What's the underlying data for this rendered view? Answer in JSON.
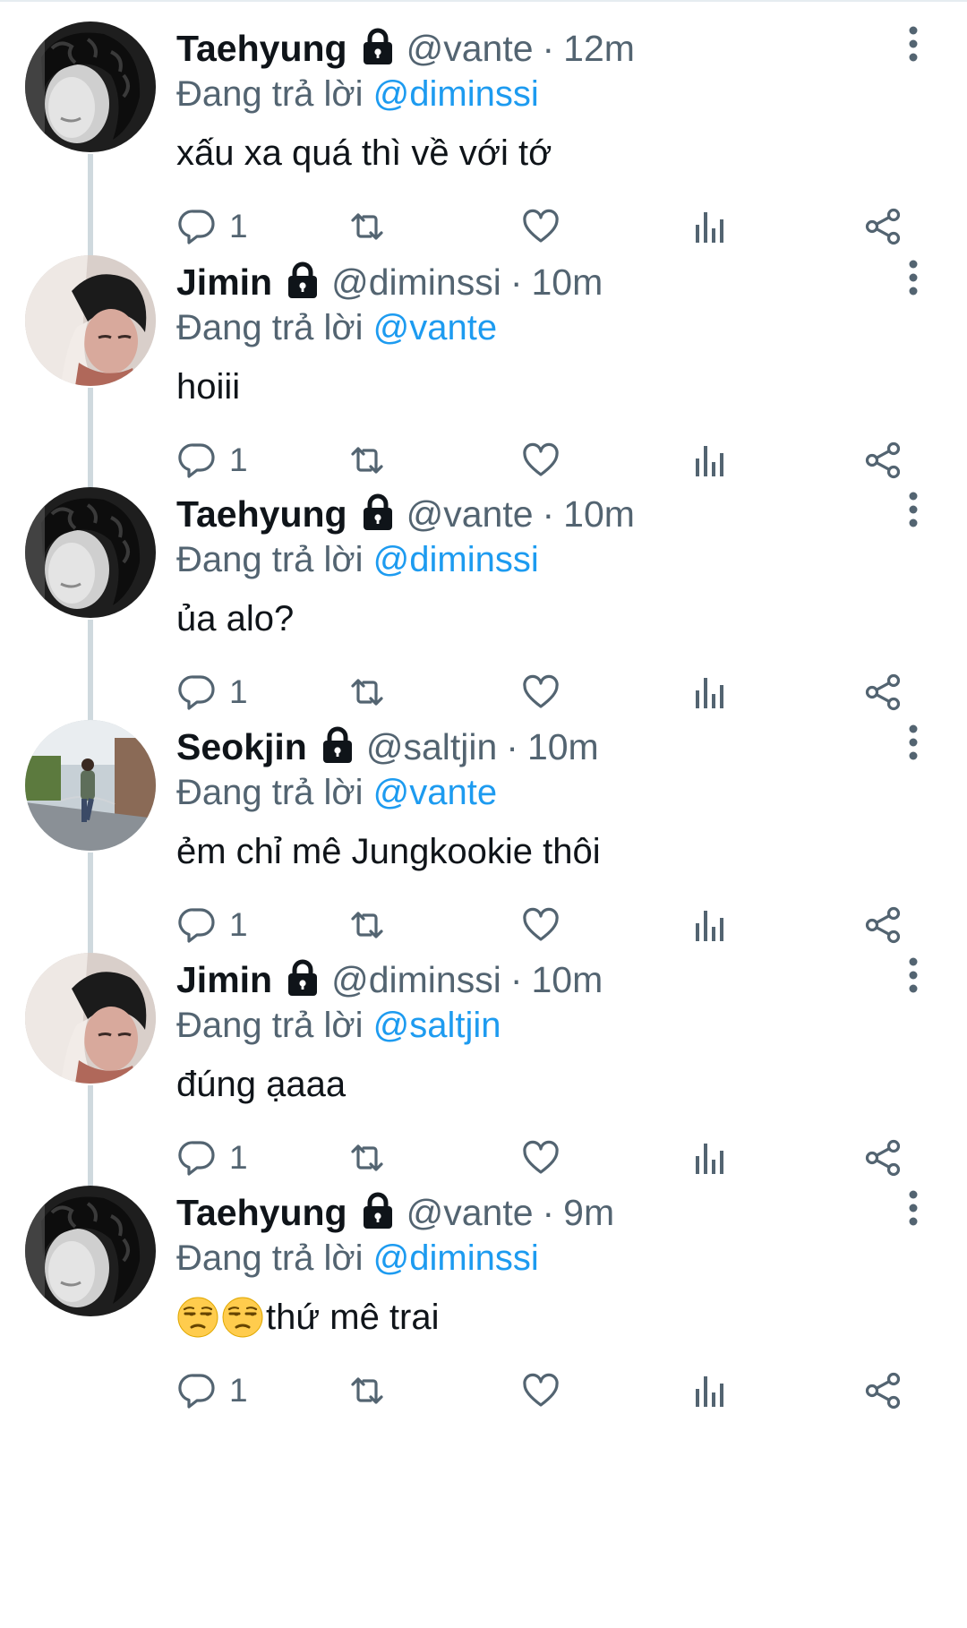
{
  "colors": {
    "text_primary": "#0f1419",
    "text_secondary": "#536471",
    "mention": "#1d9bf0",
    "thread_line": "#cfd9de",
    "icon": "#536471"
  },
  "reply_prefix": "Đang trả lời",
  "tweets": [
    {
      "display_name": "Taehyung",
      "handle": "@vante",
      "separator": "·",
      "time": "12m",
      "reply_to": "@diminssi",
      "text": "xấu xa quá thì về với tớ",
      "emojis": [],
      "reply_count": "1",
      "avatar_icon": "avatar-taehyung",
      "lock_icon": "lock-icon"
    },
    {
      "display_name": "Jimin",
      "handle": "@diminssi",
      "separator": "·",
      "time": "10m",
      "reply_to": "@vante",
      "text": "hoiii",
      "emojis": [],
      "reply_count": "1",
      "avatar_icon": "avatar-jimin",
      "lock_icon": "lock-icon"
    },
    {
      "display_name": "Taehyung",
      "handle": "@vante",
      "separator": "·",
      "time": "10m",
      "reply_to": "@diminssi",
      "text": "ủa alo?",
      "emojis": [],
      "reply_count": "1",
      "avatar_icon": "avatar-taehyung",
      "lock_icon": "lock-icon"
    },
    {
      "display_name": "Seokjin",
      "handle": "@saltjin",
      "separator": "·",
      "time": "10m",
      "reply_to": "@vante",
      "text": "ẻm chỉ mê Jungkookie thôi",
      "emojis": [],
      "reply_count": "1",
      "avatar_icon": "avatar-seokjin",
      "lock_icon": "lock-icon"
    },
    {
      "display_name": "Jimin",
      "handle": "@diminssi",
      "separator": "·",
      "time": "10m",
      "reply_to": "@saltjin",
      "text": "đúng ạaaa",
      "emojis": [],
      "reply_count": "1",
      "avatar_icon": "avatar-jimin",
      "lock_icon": "lock-icon"
    },
    {
      "display_name": "Taehyung",
      "handle": "@vante",
      "separator": "·",
      "time": "9m",
      "reply_to": "@diminssi",
      "text": "thứ mê trai",
      "emojis": [
        "unamused-face-emoji",
        "unamused-face-emoji"
      ],
      "reply_count": "1",
      "avatar_icon": "avatar-taehyung",
      "lock_icon": "lock-icon"
    }
  ],
  "action_icons": [
    "reply-icon",
    "retweet-icon",
    "like-icon",
    "analytics-icon",
    "share-icon"
  ],
  "more_icon": "more-vertical-icon"
}
